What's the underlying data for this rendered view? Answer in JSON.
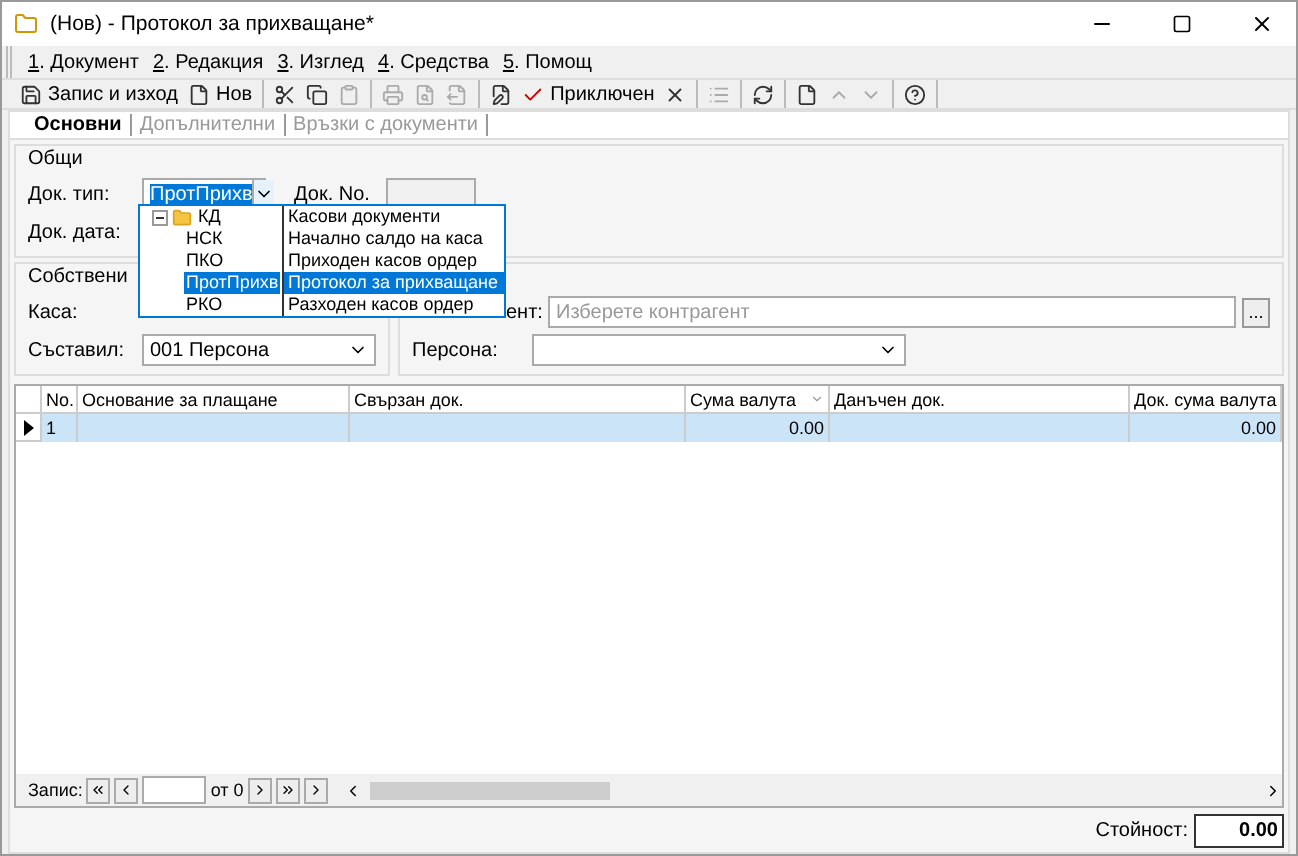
{
  "window": {
    "title": "(Нов) - Протокол за прихващане*"
  },
  "menu": [
    {
      "key": "1",
      "label": ". Документ"
    },
    {
      "key": "2",
      "label": ". Редакция"
    },
    {
      "key": "3",
      "label": ". Изглед"
    },
    {
      "key": "4",
      "label": ". Средства"
    },
    {
      "key": "5",
      "label": ". Помощ"
    }
  ],
  "toolbar": [
    [
      {
        "kind": "save",
        "label": "Запис и изход",
        "disabled": false
      },
      {
        "kind": "new",
        "label": "Нов",
        "disabled": false
      }
    ],
    [
      {
        "kind": "cut",
        "disabled": false
      },
      {
        "kind": "copy",
        "disabled": false
      },
      {
        "kind": "paste",
        "disabled": true
      }
    ],
    [
      {
        "kind": "print",
        "disabled": true
      },
      {
        "kind": "preview",
        "disabled": true
      },
      {
        "kind": "export",
        "disabled": true
      }
    ],
    [
      {
        "kind": "edit",
        "disabled": false
      },
      {
        "kind": "check",
        "label": "Приключен",
        "disabled": false
      },
      {
        "kind": "delete",
        "disabled": false
      }
    ],
    [
      {
        "kind": "list",
        "disabled": true
      }
    ],
    [
      {
        "kind": "refresh",
        "disabled": false
      }
    ],
    [
      {
        "kind": "new",
        "disabled": false
      },
      {
        "kind": "up",
        "disabled": true
      },
      {
        "kind": "down",
        "disabled": true
      }
    ],
    [
      {
        "kind": "help",
        "disabled": false
      }
    ]
  ],
  "tabs": [
    {
      "label": "Основни",
      "selected": true
    },
    {
      "label": "Допълнителни",
      "selected": false
    },
    {
      "label": "Връзки с документи",
      "selected": false
    }
  ],
  "general": {
    "title": "Общи",
    "doc_type_label": "Док. тип:",
    "doc_type_value": "ПротПрихв",
    "doc_no_label": "Док. No.",
    "doc_date_label": "Док. дата:"
  },
  "own": {
    "title": "Собствени",
    "cash_label": "Каса:",
    "author_label": "Съставил:",
    "author_value": "001 Персона"
  },
  "counterparty": {
    "label": "ент:",
    "placeholder": "Изберете контрагент",
    "browse": "...",
    "person_label": "Персона:"
  },
  "dropdown": {
    "code": "КД",
    "name": "Касови документи",
    "expanded": true,
    "children": [
      {
        "code": "НСК",
        "name": "Начално салдо на каса",
        "selected": false
      },
      {
        "code": "ПКО",
        "name": "Приходен касов ордер",
        "selected": false
      },
      {
        "code": "ПротПрихв",
        "name": "Протокол за прихващане",
        "selected": true
      },
      {
        "code": "РКО",
        "name": "Разходен касов ордер",
        "selected": false
      }
    ]
  },
  "grid": {
    "columns": [
      {
        "label": "No."
      },
      {
        "label": "Основание за плащане"
      },
      {
        "label": "Свързан док."
      },
      {
        "label": "Сума валута",
        "sorted": true
      },
      {
        "label": "Данъчен док."
      },
      {
        "label": "Док. сума валута"
      }
    ],
    "rows": [
      {
        "current": true,
        "selected": true,
        "cells": [
          "1",
          "",
          "",
          "0.00",
          "",
          "0.00"
        ]
      }
    ]
  },
  "navigator": {
    "label": "Запис:",
    "count": "от 0"
  },
  "footer": {
    "label": "Стойност:",
    "value": "0.00"
  }
}
